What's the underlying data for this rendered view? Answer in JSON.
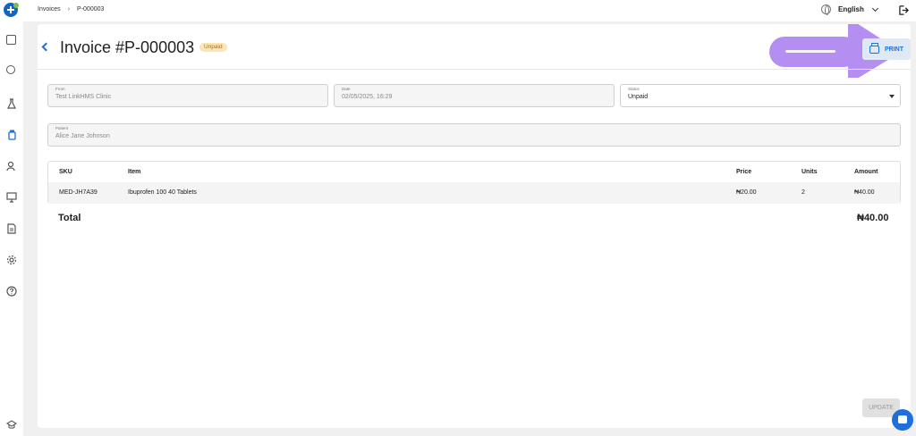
{
  "breadcrumb": {
    "parent": "Invoices",
    "separator": "›",
    "current": "P-000003"
  },
  "language": {
    "label": "English"
  },
  "invoice": {
    "title": "Invoice #P-000003",
    "status_badge": "Unpaid",
    "print_label": "PRINT"
  },
  "form": {
    "from": {
      "label": "From",
      "value": "Test LinkHMS Clinic"
    },
    "date": {
      "label": "Date",
      "value": "02/05/2025, 16:29"
    },
    "status": {
      "label": "Status",
      "value": "Unpaid"
    },
    "patient": {
      "label": "Patient",
      "value": "Alice Jane Johnson"
    }
  },
  "table": {
    "headers": {
      "sku": "SKU",
      "item": "Item",
      "price": "Price",
      "units": "Units",
      "amount": "Amount"
    },
    "rows": [
      {
        "sku": "MED-JH7A39",
        "item": "Ibuprofen 100 40 Tablets",
        "price": "₦20.00",
        "units": "2",
        "amount": "₦40.00"
      }
    ]
  },
  "total": {
    "label": "Total",
    "value": "₦40.00"
  },
  "update_label": "UPDATE",
  "colors": {
    "accent": "#1e6fd9",
    "badge_bg": "#fbe5b6",
    "badge_text": "#a8740c",
    "arrow": "#b48ef0"
  },
  "icons": [
    "app-logo-icon",
    "globe-icon",
    "chevron-down-icon",
    "logout-icon",
    "printer-icon",
    "back-arrow-icon",
    "chat-icon"
  ]
}
